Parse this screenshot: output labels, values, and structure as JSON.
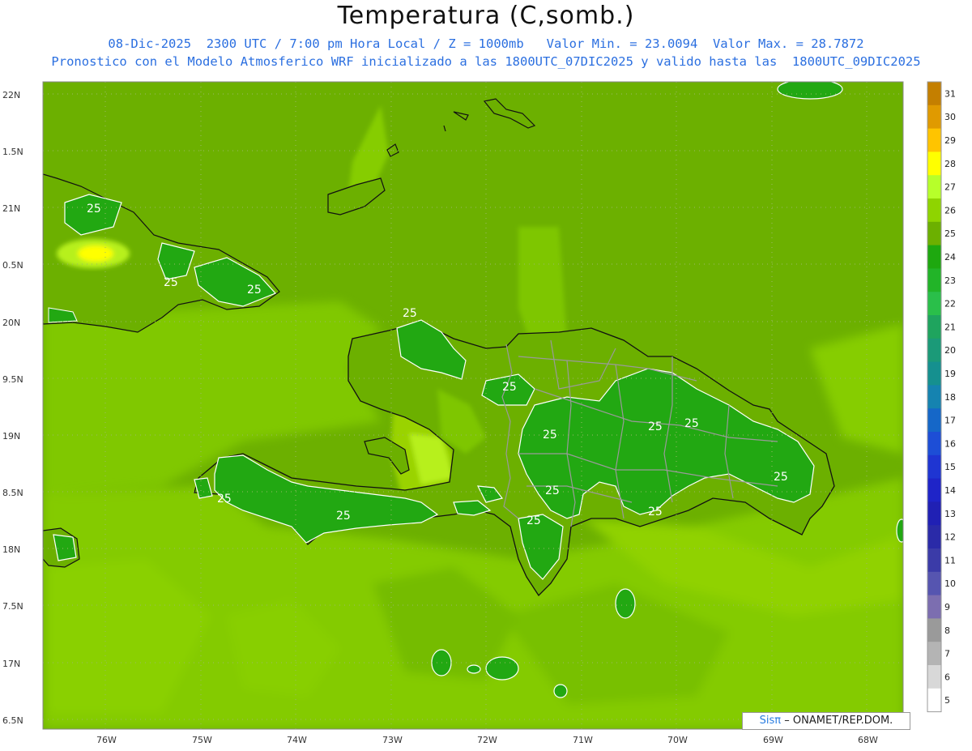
{
  "header": {
    "title": "Temperatura (C,somb.)",
    "line1": "08-Dic-2025  2300 UTC / 7:00 pm Hora Local / Z = 1000mb   Valor Min. = 23.0094  Valor Max. = 28.7872",
    "line2": "Pronostico con el Modelo Atmosferico WRF inicializado a las 1800UTC_07DIC2025 y valido hasta las  1800UTC_09DIC2025"
  },
  "map": {
    "lat_labels": [
      "22N",
      "1.5N",
      "21N",
      "0.5N",
      "20N",
      "9.5N",
      "19N",
      "8.5N",
      "18N",
      "7.5N",
      "17N",
      "6.5N"
    ],
    "lon_labels": [
      "76W",
      "75W",
      "74W",
      "73W",
      "72W",
      "71W",
      "70W",
      "69W",
      "68W"
    ],
    "contour_labels": [
      "25",
      "25",
      "25",
      "25",
      "25",
      "25",
      "25",
      "25",
      "25",
      "25",
      "25",
      "25",
      "25",
      "25"
    ],
    "colors": {
      "base": "#6cb000",
      "sea": "#80c800",
      "lowland": "#9ad300",
      "warm": "#b7f01a",
      "cool": "#22a812",
      "hot": "#fff200"
    }
  },
  "colorbar": {
    "levels": [
      "31",
      "30",
      "29",
      "28",
      "27",
      "26",
      "25",
      "24",
      "23",
      "22",
      "21",
      "20",
      "19",
      "18",
      "17",
      "16",
      "15",
      "14",
      "13",
      "12",
      "11",
      "10",
      "9",
      "8",
      "7",
      "6",
      "5"
    ],
    "colors": [
      "#c47f00",
      "#e09a00",
      "#ffc400",
      "#ffff00",
      "#b7ff2a",
      "#8fd400",
      "#6cb000",
      "#1ea80f",
      "#22b428",
      "#2abf4a",
      "#1fa45e",
      "#1b9a78",
      "#15908f",
      "#1583b0",
      "#1567c8",
      "#1d4ed6",
      "#1f35d2",
      "#1f24c8",
      "#2020b4",
      "#2a2aa8",
      "#3b3ba8",
      "#5655b0",
      "#7c6eb0",
      "#9a9a9a",
      "#b4b4b4",
      "#d8d8d8",
      "#ffffff"
    ]
  },
  "credit": {
    "logo": "Sisπ",
    "text": "– ONAMET/REP.DOM."
  }
}
